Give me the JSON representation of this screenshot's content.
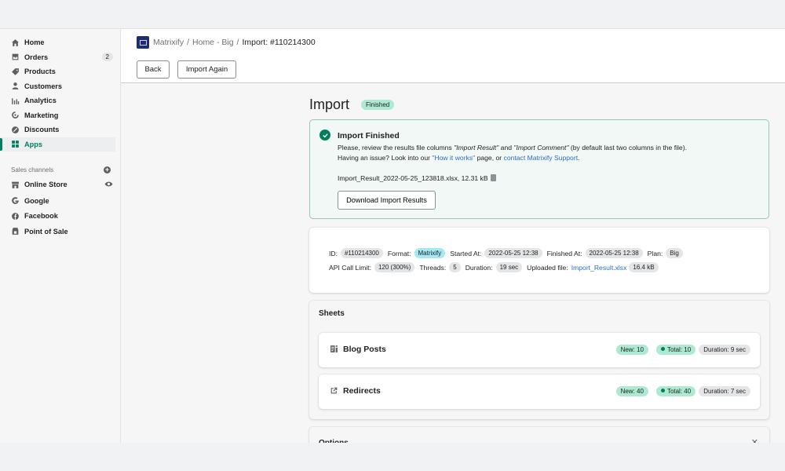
{
  "sidebar": {
    "items": [
      {
        "label": "Home",
        "icon": "home-icon"
      },
      {
        "label": "Orders",
        "icon": "orders-icon",
        "badge": "2"
      },
      {
        "label": "Products",
        "icon": "tag-icon"
      },
      {
        "label": "Customers",
        "icon": "person-icon"
      },
      {
        "label": "Analytics",
        "icon": "bar-chart-icon"
      },
      {
        "label": "Marketing",
        "icon": "target-icon"
      },
      {
        "label": "Discounts",
        "icon": "discount-icon"
      },
      {
        "label": "Apps",
        "icon": "apps-icon",
        "active": true
      }
    ],
    "sales_channels_label": "Sales channels",
    "channels": [
      {
        "label": "Online Store",
        "icon": "store-icon"
      },
      {
        "label": "Google",
        "icon": "google-icon"
      },
      {
        "label": "Facebook",
        "icon": "facebook-icon"
      },
      {
        "label": "Point of Sale",
        "icon": "pos-icon"
      }
    ]
  },
  "header": {
    "breadcrumb": {
      "app": "Matrixify",
      "sep": "/",
      "middle": "Home - Big",
      "current": "Import: #110214300"
    },
    "back_label": "Back",
    "import_again_label": "Import Again"
  },
  "page": {
    "title": "Import",
    "status": "Finished"
  },
  "banner": {
    "title": "Import Finished",
    "line1_a": "Please, review the results file columns ",
    "line1_b": "\"Import Result\"",
    "line1_c": " and ",
    "line1_d": "\"Import Comment\"",
    "line1_e": " (by default last two columns in the file).",
    "line2_a": "Having an issue? Look into our ",
    "line2_link1": "\"How it works\"",
    "line2_b": " page, or ",
    "line2_link2": "contact Matrixify Support",
    "line2_c": ".",
    "file": "Import_Result_2022-05-25_123818.xlsx, 12.31 kB",
    "download_label": "Download Import Results"
  },
  "details": {
    "id_label": "ID:",
    "id": "#110214300",
    "format_label": "Format:",
    "format": "Matrixify",
    "started_label": "Started At:",
    "started": "2022-05-25 12:38",
    "finished_label": "Finished At:",
    "finished": "2022-05-25 12:38",
    "plan_label": "Plan:",
    "plan": "Big",
    "api_label": "API Call Limit:",
    "api": "120 (300%)",
    "threads_label": "Threads:",
    "threads": "5",
    "duration_label": "Duration:",
    "duration": "19 sec",
    "uploaded_label": "Uploaded file:",
    "uploaded_file": "Import_Result.xlsx",
    "uploaded_size": "16.4 kB"
  },
  "sheets": {
    "title": "Sheets",
    "items": [
      {
        "name": "Blog Posts",
        "icon": "blog-icon",
        "new": "New: 10",
        "total": "Total: 10",
        "duration": "Duration: 9 sec"
      },
      {
        "name": "Redirects",
        "icon": "external-link-icon",
        "new": "New: 40",
        "total": "Total: 40",
        "duration": "Duration: 7 sec"
      }
    ]
  },
  "options": {
    "title": "Options"
  },
  "colors": {
    "accent": "#008060",
    "success_bg": "#f1f8f5",
    "success_border": "#95c9b4",
    "link": "#2c6ecb"
  }
}
